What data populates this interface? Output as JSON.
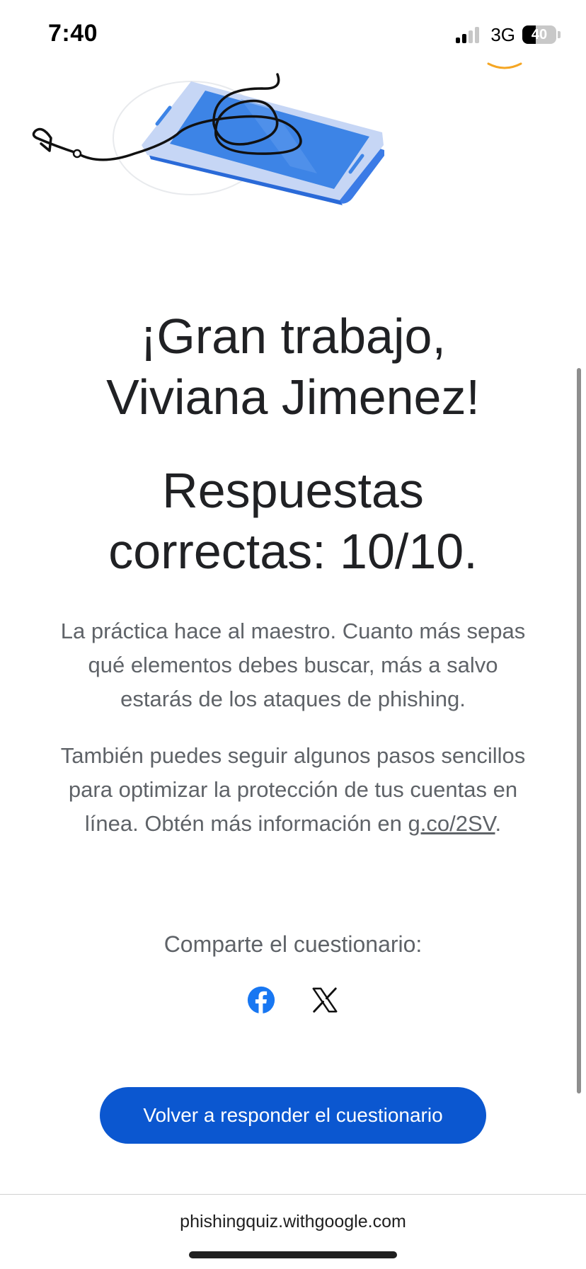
{
  "status_bar": {
    "time": "7:40",
    "network": "3G",
    "battery": "40",
    "battery_level": 0.4,
    "signal_bars_active": 2,
    "signal_bars_total": 4
  },
  "result": {
    "headline_line1": "¡Gran trabajo,",
    "headline_line2": "Viviana Jimenez!",
    "score_line1": "Respuestas",
    "score_line2": "correctas: 10/10."
  },
  "paragraphs": {
    "practice": "La práctica hace al maestro. Cuanto más sepas qué elementos debes buscar, más a salvo estarás de los ataques de phishing.",
    "steps_text": "También puedes seguir algunos pasos sencillos para optimizar la protección de tus cuentas en línea. Obtén más información en ",
    "steps_link": "g.co/2SV",
    "steps_end": "."
  },
  "share": {
    "label": "Comparte el cuestionario:",
    "icons": [
      "facebook-icon",
      "x-icon"
    ]
  },
  "actions": {
    "retake_label": "Volver a responder el cuestionario"
  },
  "browser": {
    "url": "phishingquiz.withgoogle.com"
  },
  "colors": {
    "primary_button": "#0b57d0",
    "facebook_blue": "#1877f2",
    "phone_blue": "#4285f4",
    "text_dark": "#202124",
    "text_muted": "#5f6368"
  }
}
